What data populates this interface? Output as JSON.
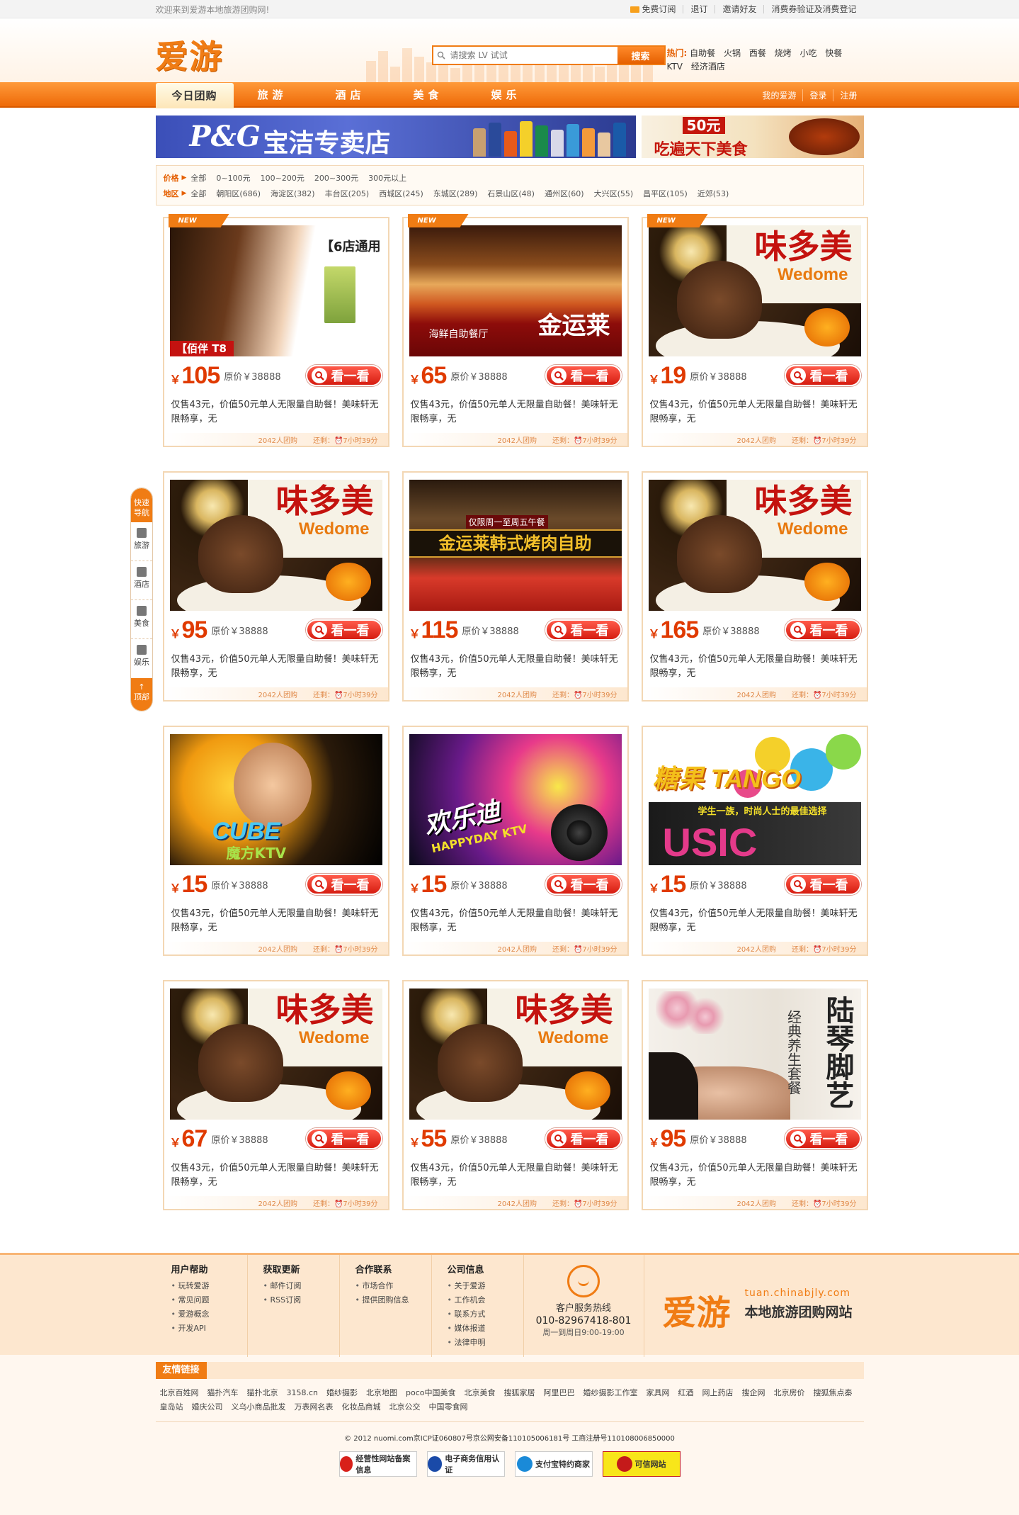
{
  "topbar": {
    "welcome": "欢迎来到爱游本地旅游团购网!",
    "links": [
      "免费订阅",
      "退订",
      "邀请好友",
      "消费券验证及消费登记"
    ]
  },
  "header": {
    "logo": "爱游",
    "search_placeholder": "请搜索 LV 试试",
    "search_button": "搜索",
    "hot_label": "热门:",
    "hot_links": [
      "自助餐",
      "火锅",
      "西餐",
      "烧烤",
      "小吃",
      "快餐",
      "KTV",
      "经济酒店"
    ]
  },
  "nav": {
    "items": [
      "今日团购",
      "旅游",
      "酒店",
      "美食",
      "娱乐"
    ],
    "right": [
      "我的爱游",
      "登录",
      "注册"
    ]
  },
  "banners": {
    "pg_logo": "P&G",
    "pg_text": "宝洁专卖店",
    "food_money": "50元",
    "food_text": "吃遍天下美食"
  },
  "filter": {
    "price_label": "价格",
    "price_options": [
      "全部",
      "0~100元",
      "100~200元",
      "200~300元",
      "300元以上"
    ],
    "area_label": "地区",
    "area_options": [
      "全部",
      "朝阳区(686)",
      "海淀区(382)",
      "丰台区(205)",
      "西城区(245)",
      "东城区(289)",
      "石景山区(48)",
      "通州区(60)",
      "大兴区(55)",
      "昌平区(105)",
      "近郊(53)"
    ]
  },
  "deal_common": {
    "orig": "原价￥38888",
    "desc": "仅售43元，价值50元单人无限量自助餐！美味轩无限畅享，无",
    "bought": "2042人团购",
    "remaining": "还剩：⏰7小时39分",
    "button": "看一看",
    "new_tag": "NEW",
    "currency": "￥"
  },
  "deals": [
    {
      "price": "105",
      "img": "hair",
      "new": true,
      "img_text": "【6店通用",
      "img_sub": "【佰伴 T8"
    },
    {
      "price": "65",
      "img": "buffet",
      "new": true,
      "img_text": "金运莱",
      "img_sub": "海鲜自助餐厅"
    },
    {
      "price": "19",
      "img": "cake",
      "new": true,
      "img_text": "味多美",
      "img_sub": "Wedome"
    },
    {
      "price": "95",
      "img": "cake",
      "new": false,
      "img_text": "味多美",
      "img_sub": "Wedome"
    },
    {
      "price": "115",
      "img": "korean",
      "new": false,
      "img_text": "金运莱韩式烤肉自助",
      "img_sub": "仅限周一至周五午餐"
    },
    {
      "price": "165",
      "img": "cake",
      "new": false,
      "img_text": "味多美",
      "img_sub": "Wedome"
    },
    {
      "price": "15",
      "img": "cube",
      "new": false,
      "img_text": "CUBE",
      "img_sub": "魔方KTV"
    },
    {
      "price": "15",
      "img": "happy",
      "new": false,
      "img_text": "欢乐迪",
      "img_sub": "HAPPYDAY KTV"
    },
    {
      "price": "15",
      "img": "tango",
      "new": false,
      "img_text": "糖果 TANGO",
      "img_sub": "学生一族，时尚人士的最佳选择"
    },
    {
      "price": "67",
      "img": "cake",
      "new": false,
      "img_text": "味多美",
      "img_sub": "Wedome"
    },
    {
      "price": "55",
      "img": "cake",
      "new": false,
      "img_text": "味多美",
      "img_sub": "Wedome"
    },
    {
      "price": "95",
      "img": "foot",
      "new": false,
      "img_text": "陆琴脚艺",
      "img_sub": "经典养生套餐"
    }
  ],
  "sidenav": {
    "top": "快速导航",
    "items": [
      "旅游",
      "酒店",
      "美食",
      "娱乐"
    ],
    "bottom": "顶部"
  },
  "footer": {
    "cols": [
      {
        "title": "用户帮助",
        "items": [
          "玩转爱游",
          "常见问题",
          "爱游概念",
          "开发API"
        ]
      },
      {
        "title": "获取更新",
        "items": [
          "邮件订阅",
          "RSS订阅"
        ]
      },
      {
        "title": "合作联系",
        "items": [
          "市场合作",
          "提供团购信息"
        ]
      },
      {
        "title": "公司信息",
        "items": [
          "关于爱游",
          "工作机会",
          "联系方式",
          "媒体报道",
          "法律申明"
        ]
      }
    ],
    "service_title": "客户服务热线",
    "service_tel": "010-82967418-801",
    "service_time": "周一到周日9:00-19:00",
    "logo": "爱游",
    "url": "tuan.chinabjly.com",
    "slogan": "本地旅游团购网站",
    "links_title": "友情链接",
    "links": [
      "北京百姓网",
      "猫扑汽车",
      "猫扑北京",
      "3158.cn",
      "婚纱摄影",
      "北京地图",
      "poco中国美食",
      "北京美食",
      "搜狐家居",
      "阿里巴巴",
      "婚纱摄影工作室",
      "家具网",
      "红酒",
      "网上药店",
      "搜企网",
      "北京房价",
      "搜狐焦点秦皇岛站",
      "婚庆公司",
      "义乌小商品批发",
      "万表网名表",
      "化妆品商城",
      "北京公交",
      "中国零食网"
    ],
    "copyright": "© 2012 nuomi.com京ICP证060807号京公网安备110105006181号 工商注册号110108006850000",
    "badges": [
      "经营性网站备案信息",
      "电子商务信用认证",
      "支付宝特约商家",
      "可信网站"
    ],
    "colors": {
      "accent": "#f07c14",
      "price": "#e03a00"
    }
  }
}
